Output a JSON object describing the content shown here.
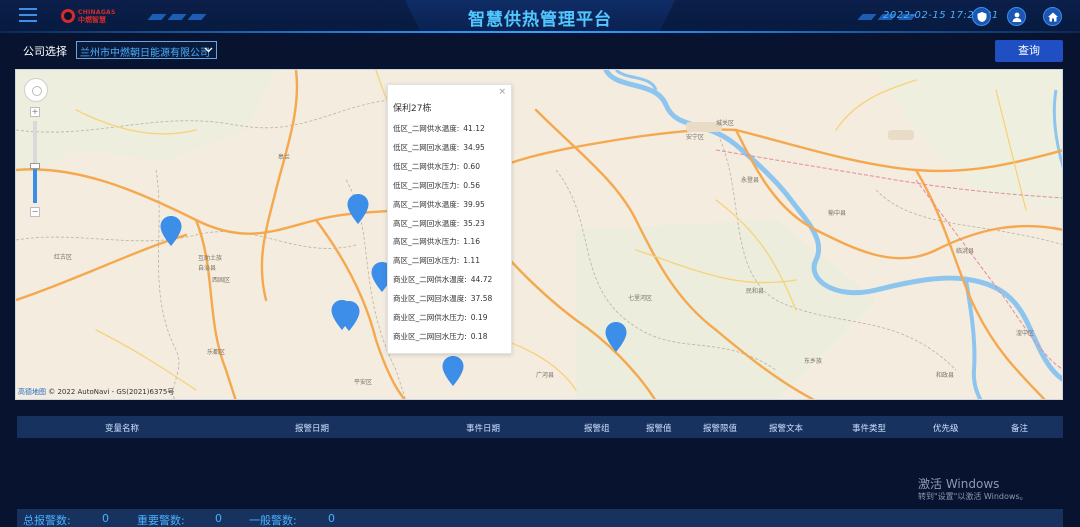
{
  "header": {
    "logo_top": "CHINAGAS",
    "logo_bottom": "中燃智慧",
    "title": "智慧供热管理平台",
    "datetime": "2022-02-15 17:21:21",
    "icons": [
      "menu-icon",
      "shield-icon",
      "user-icon",
      "home-icon"
    ],
    "accent_color": "#52c7ff"
  },
  "filter": {
    "company_label": "公司选择",
    "company_value": "兰州市中燃朝日能源有限公司",
    "query_button": "查询"
  },
  "map": {
    "popup": {
      "title": "保利27栋",
      "close_symbol": "×",
      "rows": [
        {
          "label": "低区_二网供水温度:",
          "value": "41.12"
        },
        {
          "label": "低区_二网回水温度:",
          "value": "34.95"
        },
        {
          "label": "低区_二网供水压力:",
          "value": "0.60"
        },
        {
          "label": "低区_二网回水压力:",
          "value": "0.56"
        },
        {
          "label": "高区_二网供水温度:",
          "value": "39.95"
        },
        {
          "label": "高区_二网回水温度:",
          "value": "35.23"
        },
        {
          "label": "高区_二网供水压力:",
          "value": "1.16"
        },
        {
          "label": "高区_二网回水压力:",
          "value": "1.11"
        },
        {
          "label": "商业区_二网供水温度:",
          "value": "44.72"
        },
        {
          "label": "商业区_二网回水温度:",
          "value": "37.58"
        },
        {
          "label": "商业区_二网供水压力:",
          "value": "0.19"
        },
        {
          "label": "商业区_二网回水压力:",
          "value": "0.18"
        }
      ]
    },
    "labels": [
      "皋兰",
      "永登县",
      "榆中县",
      "临洮县",
      "西固区",
      "七里河区",
      "安宁区",
      "城关区",
      "红古区",
      "互助土族",
      "自治县",
      "乐都区",
      "平安区",
      "民和县",
      "湟中区",
      "东乡族",
      "和政县",
      "广河县"
    ],
    "zoom_plus": "+",
    "zoom_minus": "−",
    "zoom_level": 0.45,
    "attribution_brand": "高德地图",
    "attribution_text": "© 2022 AutoNavi - GS(2021)6375号"
  },
  "alarm_table": {
    "columns": [
      "变量名称",
      "报警日期",
      "事件日期",
      "报警组",
      "报警值",
      "报警限值",
      "报警文本",
      "事件类型",
      "优先级",
      "备注"
    ],
    "rows": []
  },
  "activation": {
    "title": "激活 Windows",
    "subtitle": "转到\"设置\"以激活 Windows。"
  },
  "footer": {
    "total_label": "总报警数:",
    "total_value": "0",
    "major_label": "重要警数:",
    "major_value": "0",
    "normal_label": "一般警数:",
    "normal_value": "0"
  }
}
